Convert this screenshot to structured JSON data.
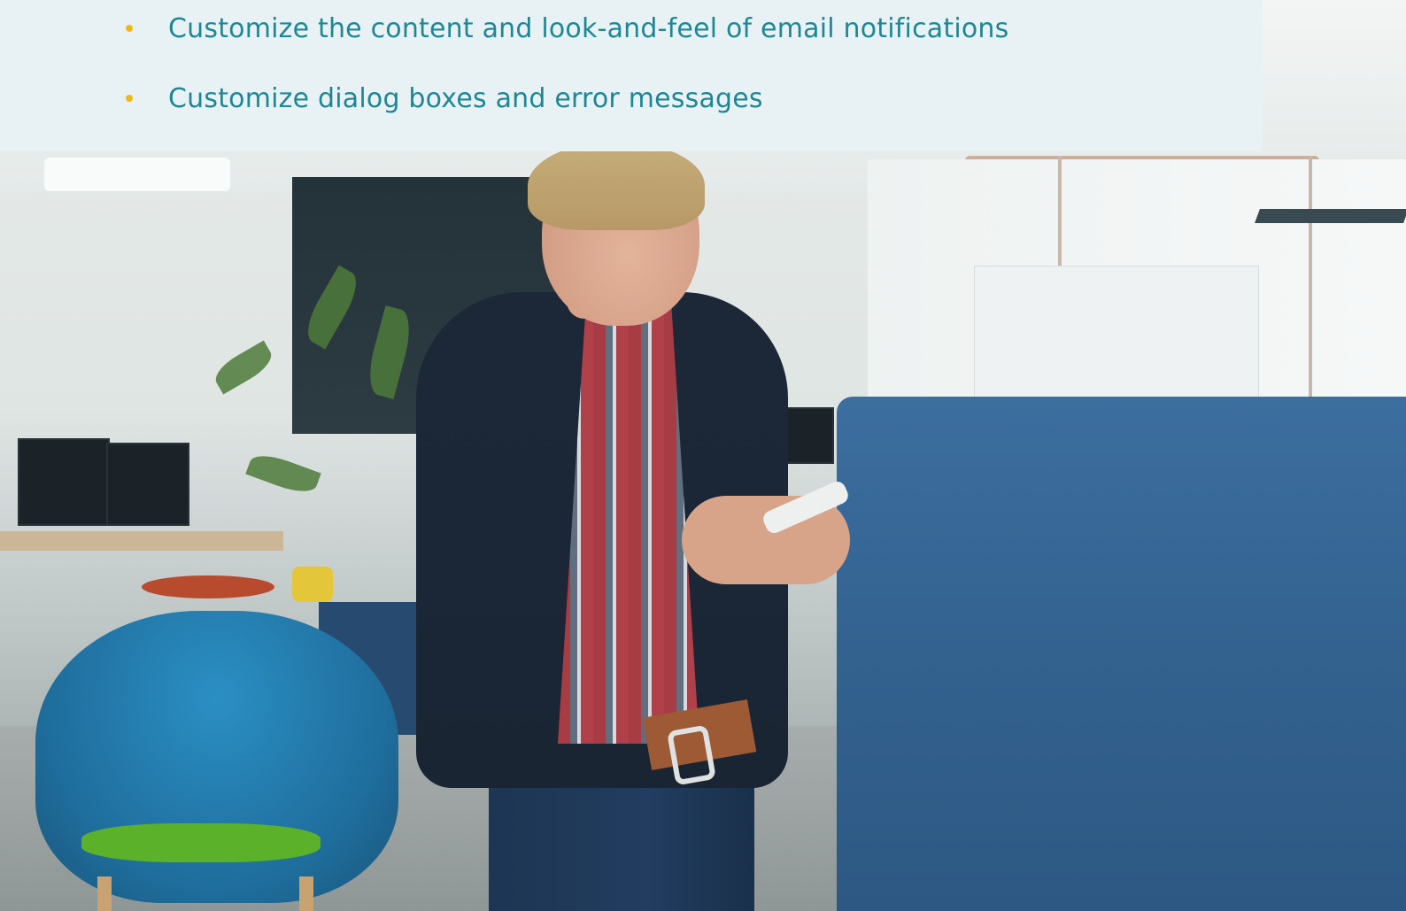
{
  "panel": {
    "bullets": [
      {
        "text": "Customize the content and look-and-feel of email notifications"
      },
      {
        "text": "Customize dialog boxes and error messages"
      }
    ]
  },
  "colors": {
    "panel_background": "#e8f2f4",
    "text": "#1e8795",
    "bullet": "#f2b818"
  },
  "background_photo": {
    "subject-icon": "person-photo"
  }
}
